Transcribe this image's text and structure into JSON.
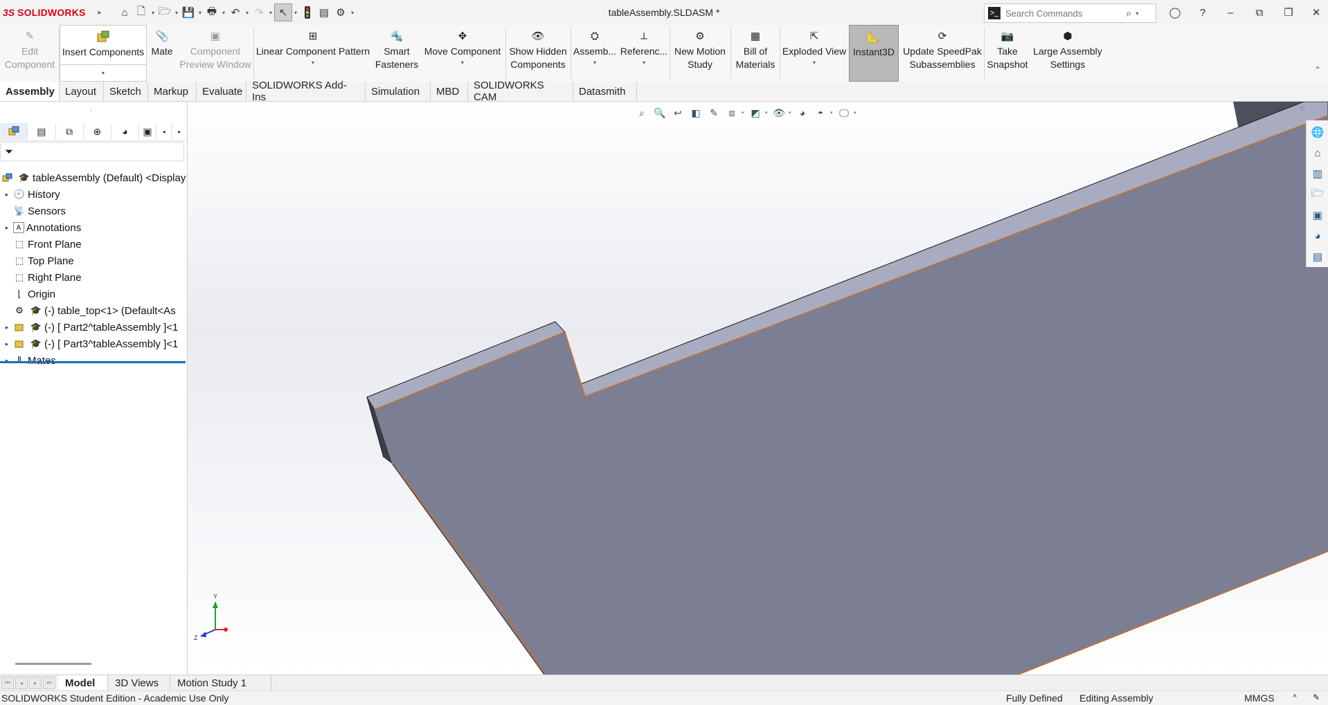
{
  "app": {
    "logo_ds": "3S",
    "logo_text": "SOLIDWORKS",
    "document_title": "tableAssembly.SLDASM *"
  },
  "search": {
    "placeholder": "Search Commands"
  },
  "commands": {
    "edit_component": [
      "Edit",
      "Component"
    ],
    "insert_components": "Insert Components",
    "mate": "Mate",
    "component_preview": [
      "Component",
      "Preview Window"
    ],
    "linear_pattern": "Linear Component Pattern",
    "smart_fasteners": [
      "Smart",
      "Fasteners"
    ],
    "move_component": "Move Component",
    "show_hidden": [
      "Show Hidden",
      "Components"
    ],
    "assembly_features": "Assemb...",
    "reference_geometry": "Referenc...",
    "new_motion_study": [
      "New Motion",
      "Study"
    ],
    "bill_of_materials": [
      "Bill of",
      "Materials"
    ],
    "exploded_view": "Exploded View",
    "instant3d": "Instant3D",
    "speedpak": [
      "Update SpeedPak",
      "Subassemblies"
    ],
    "take_snapshot": [
      "Take",
      "Snapshot"
    ],
    "large_assembly": [
      "Large Assembly",
      "Settings"
    ]
  },
  "tabs": [
    "Assembly",
    "Layout",
    "Sketch",
    "Markup",
    "Evaluate",
    "SOLIDWORKS Add-Ins",
    "Simulation",
    "MBD",
    "SOLIDWORKS CAM",
    "Datasmith"
  ],
  "tree": {
    "root": "tableAssembly (Default) <Display",
    "items": [
      {
        "label": "History",
        "icon": "history-icon"
      },
      {
        "label": "Sensors",
        "icon": "sensor-icon"
      },
      {
        "label": "Annotations",
        "icon": "annotations-icon"
      },
      {
        "label": "Front Plane",
        "icon": "plane-icon"
      },
      {
        "label": "Top Plane",
        "icon": "plane-icon"
      },
      {
        "label": "Right Plane",
        "icon": "plane-icon"
      },
      {
        "label": "Origin",
        "icon": "origin-icon"
      },
      {
        "label": "(-) table_top<1> (Default<As",
        "icon": "part-icon"
      },
      {
        "label": "(-) [ Part2^tableAssembly ]<1",
        "icon": "part-icon"
      },
      {
        "label": "(-) [ Part3^tableAssembly ]<1",
        "icon": "part-icon"
      },
      {
        "label": "Mates",
        "icon": "mates-icon"
      }
    ]
  },
  "triad": {
    "x": "X",
    "y": "Y",
    "z": "Z"
  },
  "bottom_tabs": [
    "Model",
    "3D Views",
    "Motion Study 1"
  ],
  "status": {
    "edition": "SOLIDWORKS Student Edition - Academic Use Only",
    "definition": "Fully Defined",
    "mode": "Editing Assembly",
    "units": "MMGS",
    "units_arrow": "˄"
  },
  "colors": {
    "part_face": "#7c7f93",
    "part_edge_highlight": "#c8702a",
    "top_face": "#a9abc0",
    "brand_red": "#d0021b",
    "selection_blue": "#1c6fb8"
  }
}
